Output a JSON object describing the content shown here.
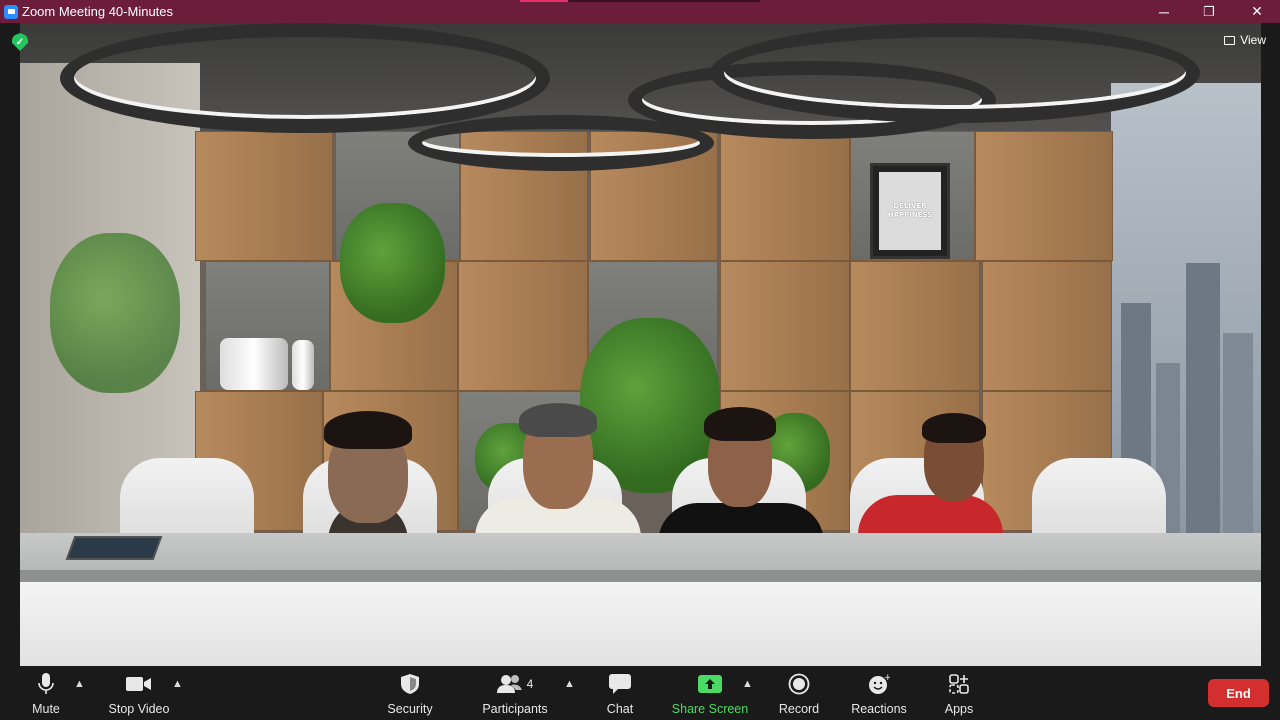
{
  "window": {
    "title": "Zoom Meeting 40-Minutes",
    "minimize": "─",
    "restore": "❐",
    "close": "✕",
    "progress": 0.2
  },
  "overlay": {
    "view_label": "View",
    "secure_icon": "shield-check-icon"
  },
  "background": {
    "poster_text": "DELIVER HAPPINESS"
  },
  "toolbar": {
    "mute_label": "Mute",
    "stop_video_label": "Stop Video",
    "security_label": "Security",
    "participants_label": "Participants",
    "participants_count": "4",
    "chat_label": "Chat",
    "share_screen_label": "Share Screen",
    "record_label": "Record",
    "reactions_label": "Reactions",
    "apps_label": "Apps",
    "end_label": "End"
  },
  "colors": {
    "titlebar": "#6b1d3a",
    "share_green": "#4cd964",
    "end_red": "#d32f2f"
  }
}
